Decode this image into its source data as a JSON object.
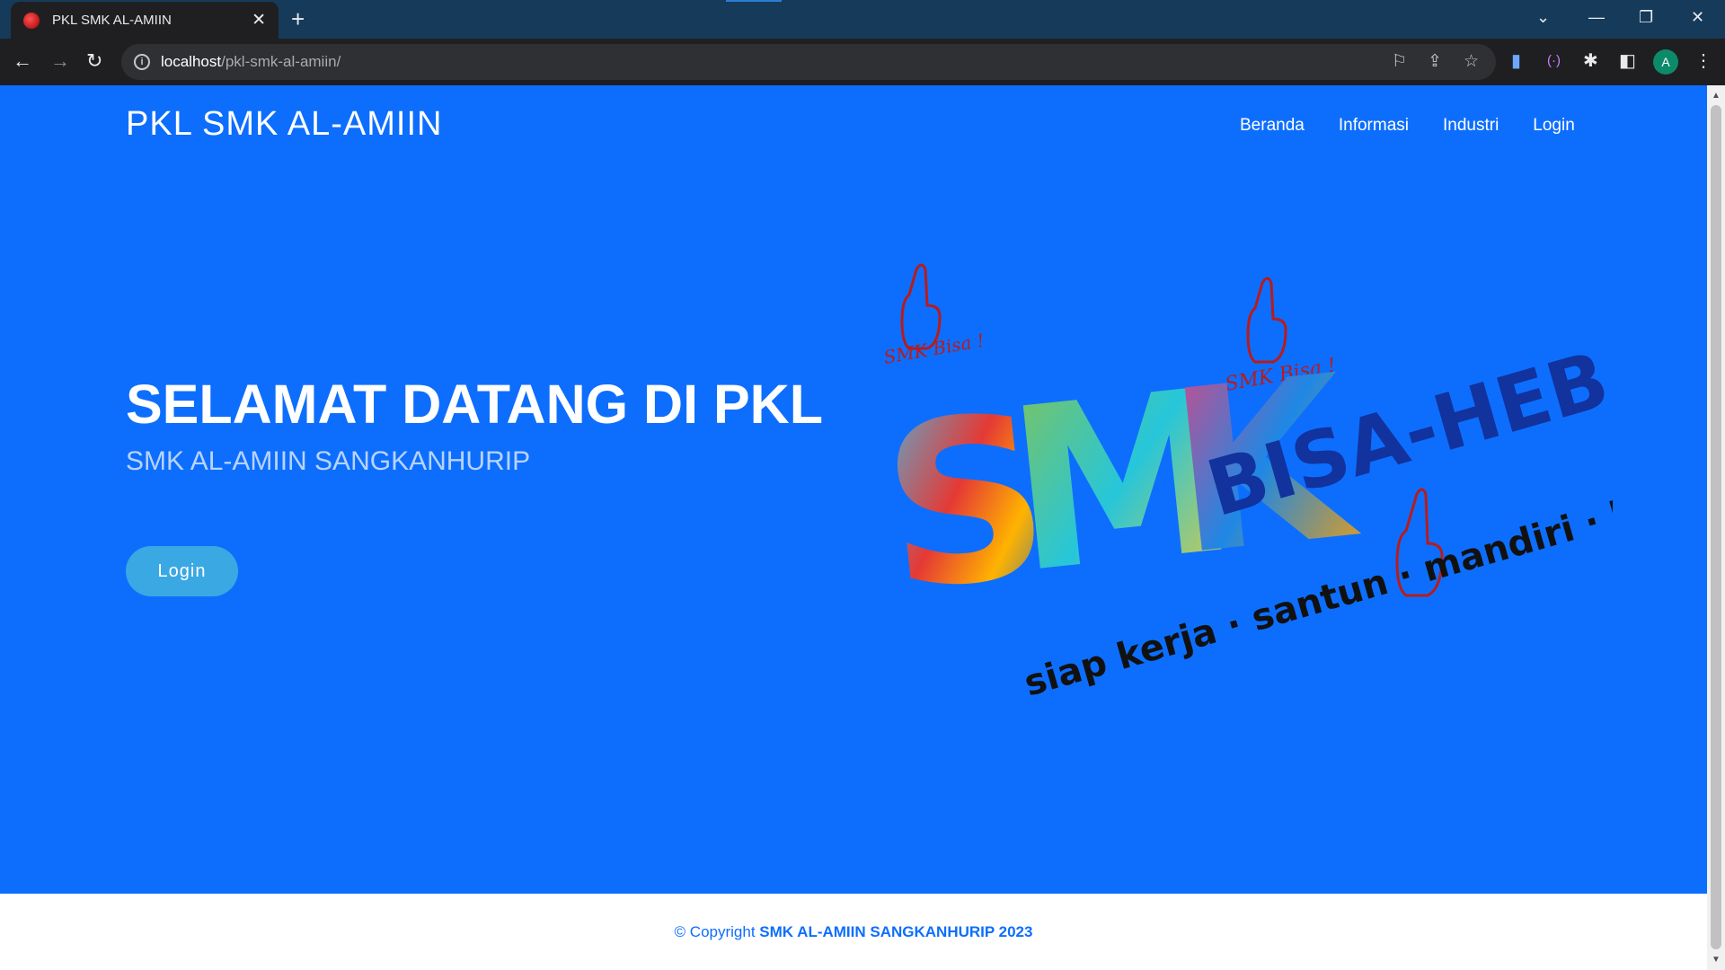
{
  "browser": {
    "tab_title": "PKL SMK AL-AMIIN",
    "url_host": "localhost",
    "url_path": "/pkl-smk-al-amiin/",
    "profile_initial": "A"
  },
  "nav": {
    "brand": "PKL SMK AL-AMIIN",
    "links": [
      "Beranda",
      "Informasi",
      "Industri",
      "Login"
    ]
  },
  "hero": {
    "title": "SELAMAT DATANG DI PKL",
    "subtitle": "SMK AL-AMIIN SANGKANHURIP",
    "button_label": "Login"
  },
  "logo": {
    "big_letters": "SMK",
    "tagline_top": "BISA-HEBAT",
    "tagline_bottom": "siap kerja · santun · mandiri · kreatif",
    "caption_left": "SMK Bisa !",
    "caption_right": "SMK Bisa !"
  },
  "footer": {
    "prefix": "© Copyright",
    "strong": "SMK AL-AMIIN SANGKANHURIP 2023"
  },
  "colors": {
    "page_bg": "#0d6efd",
    "button_bg": "#3aa8e3",
    "footer_text": "#0d6efd"
  }
}
